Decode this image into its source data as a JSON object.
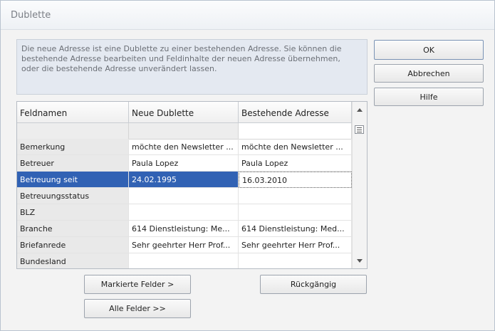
{
  "window": {
    "title": "Dublette"
  },
  "info": {
    "text": "Die neue Adresse ist eine Dublette zu einer bestehenden Adresse. Sie können die bestehende Adresse bearbeiten und Feldinhalte der neuen Adresse übernehmen, oder die bestehende Adresse unverändert lassen."
  },
  "buttons": {
    "ok": "OK",
    "cancel": "Abbrechen",
    "help": "Hilfe",
    "marked_fields": "Markierte Felder >",
    "undo": "Rückgängig",
    "all_fields": "Alle Felder >>"
  },
  "grid": {
    "columns": [
      "Feldnamen",
      "Neue Dublette",
      "Bestehende Adresse"
    ],
    "rows": [
      {
        "field": "Bemerkung",
        "new": "möchte den Newsletter ...",
        "existing": "möchte den Newsletter ..."
      },
      {
        "field": "Betreuer",
        "new": "Paula Lopez",
        "existing": "Paula Lopez"
      },
      {
        "field": "Betreuung seit",
        "new": "24.02.1995",
        "existing": "16.03.2010",
        "selected": true
      },
      {
        "field": "Betreuungsstatus",
        "new": "",
        "existing": ""
      },
      {
        "field": "BLZ",
        "new": "",
        "existing": ""
      },
      {
        "field": "Branche",
        "new": "614 Dienstleistung: Me...",
        "existing": "614 Dienstleistung: Med..."
      },
      {
        "field": "Briefanrede",
        "new": "Sehr geehrter Herr Prof...",
        "existing": "Sehr geehrter Herr Prof..."
      },
      {
        "field": "Bundesland",
        "new": "",
        "existing": ""
      }
    ]
  },
  "icons": {
    "list": "list-icon",
    "scroll_up": "scroll-up-arrow-icon",
    "scroll_down": "scroll-down-arrow-icon"
  },
  "colors": {
    "selection": "#3162b4",
    "info_bg": "#e4e9f1"
  }
}
